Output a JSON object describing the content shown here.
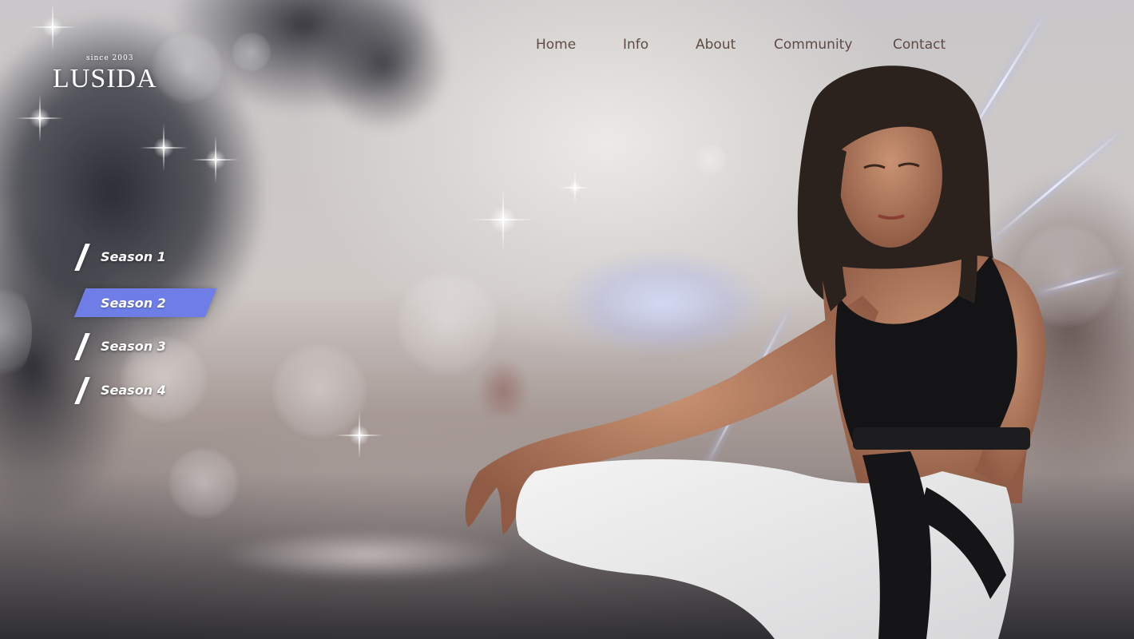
{
  "logo": {
    "since": "since 2003",
    "name": "LUSIDA"
  },
  "nav": {
    "items": [
      {
        "label": "Home"
      },
      {
        "label": "Info"
      },
      {
        "label": "About"
      },
      {
        "label": "Community"
      },
      {
        "label": "Contact"
      }
    ]
  },
  "seasons": {
    "items": [
      {
        "label": "Season 1",
        "active": false
      },
      {
        "label": "Season 2",
        "active": true
      },
      {
        "label": "Season 3",
        "active": false
      },
      {
        "label": "Season 4",
        "active": false
      }
    ]
  },
  "colors": {
    "nav_text": "#5e4b45",
    "active_season": "#6f7ee6"
  }
}
